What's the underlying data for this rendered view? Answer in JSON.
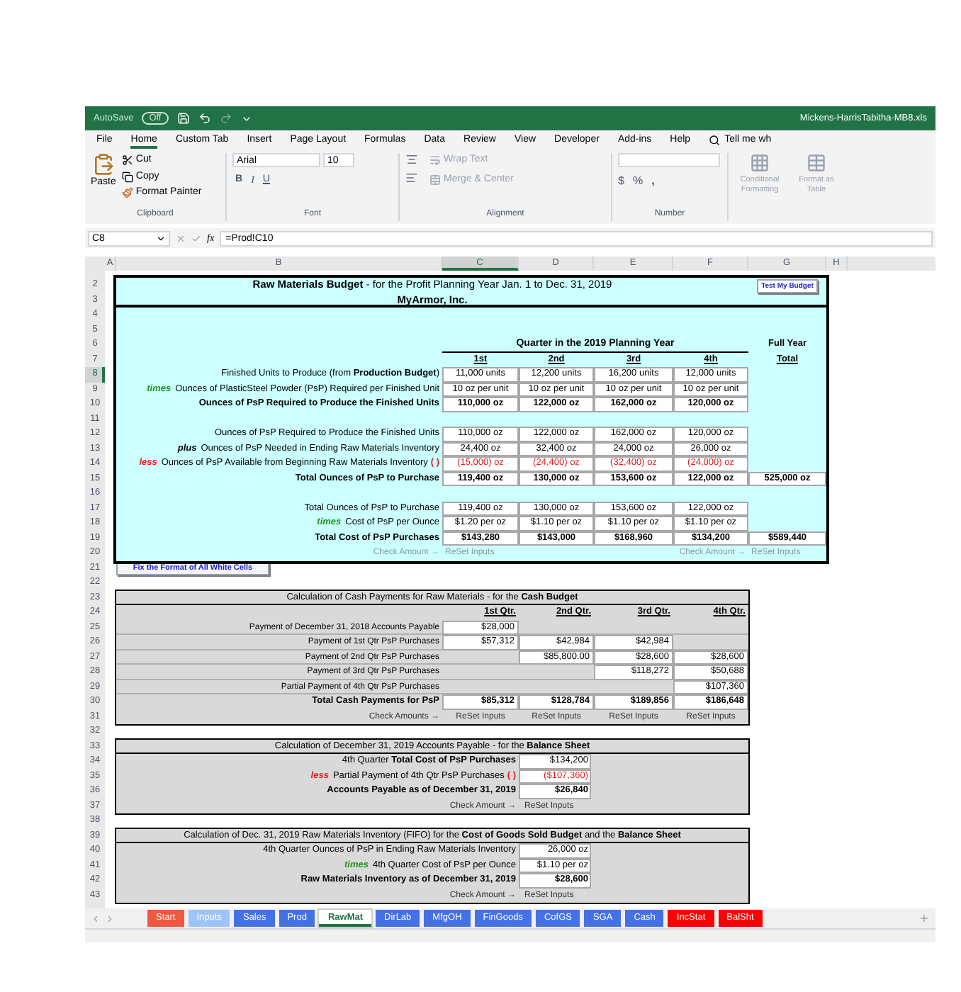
{
  "title_bar": {
    "autosave": "AutoSave",
    "autosave_state": "Off",
    "file_name": "Mickens-HarrisTabitha-MB8.xls"
  },
  "ribbon_tabs": [
    {
      "label": "File",
      "selected": false
    },
    {
      "label": "Home",
      "selected": true
    },
    {
      "label": "Custom Tab",
      "selected": false
    },
    {
      "label": "Insert",
      "selected": false
    },
    {
      "label": "Page Layout",
      "selected": false
    },
    {
      "label": "Formulas",
      "selected": false
    },
    {
      "label": "Data",
      "selected": false
    },
    {
      "label": "Review",
      "selected": false
    },
    {
      "label": "View",
      "selected": false
    },
    {
      "label": "Developer",
      "selected": false
    },
    {
      "label": "Add-ins",
      "selected": false
    },
    {
      "label": "Help",
      "selected": false
    }
  ],
  "tell_me": "Tell me wh",
  "ribbon": {
    "clipboard": {
      "paste": "Paste",
      "cut": "Cut",
      "copy": "Copy",
      "format_painter": "Format Painter",
      "group": "Clipboard"
    },
    "font": {
      "name": "Arial",
      "size": "10",
      "bold": "B",
      "italic": "I",
      "underline": "U",
      "group": "Font"
    },
    "alignment": {
      "wrap": "Wrap Text",
      "merge": "Merge & Center",
      "group": "Alignment"
    },
    "number": {
      "currency": "$",
      "percent": "%",
      "comma": ",",
      "group": "Number"
    },
    "styles": [
      {
        "label": "Conditional Formatting"
      },
      {
        "label": "Format as Table"
      }
    ]
  },
  "formula_bar": {
    "cell": "C8",
    "fx": "fx",
    "formula": "=Prod!C10"
  },
  "columns": [
    {
      "label": "A",
      "selected": false
    },
    {
      "label": "B",
      "selected": false
    },
    {
      "label": "C",
      "selected": true
    },
    {
      "label": "D",
      "selected": false
    },
    {
      "label": "E",
      "selected": false
    },
    {
      "label": "F",
      "selected": false
    },
    {
      "label": "G",
      "selected": false
    },
    {
      "label": "H",
      "selected": false
    }
  ],
  "row_numbers": [
    {
      "label": "2",
      "selected": false
    },
    {
      "label": "3",
      "selected": false
    },
    {
      "label": "4",
      "selected": false
    },
    {
      "label": "5",
      "selected": false
    },
    {
      "label": "6",
      "selected": false
    },
    {
      "label": "7",
      "selected": false
    },
    {
      "label": "8",
      "selected": true
    },
    {
      "label": "9",
      "selected": false
    },
    {
      "label": "10",
      "selected": false
    },
    {
      "label": "11",
      "selected": false
    },
    {
      "label": "12",
      "selected": false
    },
    {
      "label": "13",
      "selected": false
    },
    {
      "label": "14",
      "selected": false
    },
    {
      "label": "15",
      "selected": false
    },
    {
      "label": "16",
      "selected": false
    },
    {
      "label": "17",
      "selected": false
    },
    {
      "label": "18",
      "selected": false
    },
    {
      "label": "19",
      "selected": false
    },
    {
      "label": "20",
      "selected": false
    },
    {
      "label": "21",
      "selected": false
    },
    {
      "label": "22",
      "selected": false
    },
    {
      "label": "23",
      "selected": false
    },
    {
      "label": "24",
      "selected": false
    },
    {
      "label": "25",
      "selected": false
    },
    {
      "label": "26",
      "selected": false
    },
    {
      "label": "27",
      "selected": false
    },
    {
      "label": "28",
      "selected": false
    },
    {
      "label": "29",
      "selected": false
    },
    {
      "label": "30",
      "selected": false
    },
    {
      "label": "31",
      "selected": false
    },
    {
      "label": "32",
      "selected": false
    },
    {
      "label": "33",
      "selected": false
    },
    {
      "label": "34",
      "selected": false
    },
    {
      "label": "35",
      "selected": false
    },
    {
      "label": "36",
      "selected": false
    },
    {
      "label": "37",
      "selected": false
    },
    {
      "label": "38",
      "selected": false
    },
    {
      "label": "39",
      "selected": false
    },
    {
      "label": "40",
      "selected": false
    },
    {
      "label": "41",
      "selected": false
    },
    {
      "label": "42",
      "selected": false
    },
    {
      "label": "43",
      "selected": false
    }
  ],
  "budget": {
    "title": "**Raw Materials Budget** - for the Profit Planning Year Jan. 1 to Dec. 31, 2019",
    "company": "MyArmor, Inc.",
    "test_button": "Test My Budget",
    "quarter_header": "Quarter in the 2019 Planning Year",
    "total_header": [
      "Full Year",
      "Total"
    ],
    "quarters": [
      "1st",
      "2nd",
      "3rd",
      "4th"
    ],
    "groups": [
      [
        {
          "label": "Finished Units to Produce (from **Production Budget**)",
          "values": [
            "11,000 units",
            "12,200 units",
            "16,200 units",
            "12,000 units"
          ]
        },
        {
          "prefix": {
            "text": "times",
            "kind": "times"
          },
          "label": "Ounces of PlasticSteel Powder (PsP) Required per Finished Unit",
          "values": [
            "10 oz per unit",
            "10 oz per unit",
            "10 oz per unit",
            "10 oz per unit"
          ]
        },
        {
          "label": "Ounces of PsP Required to Produce the Finished Units",
          "bold": true,
          "values": [
            "110,000 oz",
            "122,000 oz",
            "162,000 oz",
            "120,000 oz"
          ]
        }
      ],
      [
        {
          "label": "Ounces of PsP Required to Produce the Finished Units",
          "values": [
            "110,000 oz",
            "122,000 oz",
            "162,000 oz",
            "120,000 oz"
          ]
        },
        {
          "prefix": {
            "text": "plus",
            "kind": "plus"
          },
          "label": "Ounces of PsP Needed in Ending Raw Materials Inventory",
          "values": [
            "24,400 oz",
            "32,400 oz",
            "24,000 oz",
            "26,000 oz"
          ]
        },
        {
          "prefix": {
            "text": "less",
            "kind": "less"
          },
          "label": "Ounces of PsP Available from Beginning Raw Materials Inventory",
          "suffix": "( )",
          "negative": true,
          "values": [
            "(15,000) oz",
            "(24,400) oz",
            "(32,400) oz",
            "(24,000) oz"
          ]
        },
        {
          "label": "Total Ounces of PsP to Purchase",
          "bold": true,
          "values": [
            "119,400 oz",
            "130,000 oz",
            "153,600 oz",
            "122,000 oz"
          ],
          "total": "525,000 oz"
        }
      ],
      [
        {
          "label": "Total Ounces of PsP to Purchase",
          "values": [
            "119,400 oz",
            "130,000 oz",
            "153,600 oz",
            "122,000 oz"
          ]
        },
        {
          "prefix": {
            "text": "times",
            "kind": "times"
          },
          "label": "Cost of PsP per Ounce",
          "values": [
            "$1.20 per oz",
            "$1.10 per oz",
            "$1.10 per oz",
            "$1.10 per oz"
          ]
        },
        {
          "label": "Total Cost of PsP Purchases",
          "bold": true,
          "values": [
            "$143,280",
            "$143,000",
            "$168,960",
            "$134,200"
          ],
          "total": "$589,440"
        }
      ]
    ],
    "checks": [
      {
        "label": "Check Amount →",
        "action": "ReSet Inputs"
      },
      {
        "label": "Check Amount →",
        "action": "ReSet Inputs"
      }
    ]
  },
  "fix_button": "Fix the Format of All White Cells",
  "cash": {
    "title": "Calculation of Cash Payments for Raw Materials - for the **Cash Budget**",
    "quarters": [
      "1st Qtr.",
      "2nd Qtr.",
      "3rd Qtr.",
      "4th Qtr."
    ],
    "rows": [
      {
        "label": "Payment of  December 31, 2018 Accounts Payable",
        "cells": [
          {
            "kind": "value",
            "text": "$28,000"
          },
          {
            "kind": "blank"
          },
          {
            "kind": "blank"
          },
          {
            "kind": "blank"
          }
        ]
      },
      {
        "label": "Payment of 1st Qtr PsP Purchases",
        "cells": [
          {
            "kind": "value",
            "text": "$57,312"
          },
          {
            "kind": "value",
            "text": "$42,984"
          },
          {
            "kind": "value",
            "text": "$42,984"
          },
          {
            "kind": "blank"
          }
        ]
      },
      {
        "label": "Payment of 2nd Qtr PsP Purchases",
        "cells": [
          {
            "kind": "blank"
          },
          {
            "kind": "value",
            "text": "$85,800.00"
          },
          {
            "kind": "value",
            "text": "$28,600"
          },
          {
            "kind": "value",
            "text": "$28,600"
          }
        ]
      },
      {
        "label": "Payment of 3rd Qtr PsP Purchases",
        "cells": [
          {
            "kind": "blank"
          },
          {
            "kind": "blank"
          },
          {
            "kind": "value",
            "text": "$118,272"
          },
          {
            "kind": "value",
            "text": "$50,688"
          }
        ]
      },
      {
        "label": "Partial Payment of 4th Qtr PsP Purchases",
        "cells": [
          {
            "kind": "blank"
          },
          {
            "kind": "blank"
          },
          {
            "kind": "blank"
          },
          {
            "kind": "value",
            "text": "$107,360"
          }
        ]
      }
    ],
    "total": {
      "label": "Total Cash Payments for PsP",
      "values": [
        "$85,312",
        "$128,784",
        "$189,856",
        "$186,648"
      ]
    },
    "check": {
      "label": "Check Amounts →",
      "actions": [
        "ReSet Inputs",
        "ReSet Inputs",
        "ReSet Inputs",
        "ReSet Inputs"
      ]
    }
  },
  "payable": {
    "title": "Calculation of December 31, 2019 Accounts Payable - for the **Balance Sheet**",
    "rows": [
      {
        "label": "4th Quarter **Total Cost of PsP Purchases**",
        "value": "$134,200"
      },
      {
        "prefix": {
          "text": "less",
          "kind": "less"
        },
        "label": "Partial Payment of 4th Qtr PsP Purchases",
        "suffix": "( )",
        "negative": true,
        "value": "($107,360)"
      },
      {
        "label": "Accounts Payable as of December 31, 2019",
        "bold": true,
        "value": "$26,840"
      }
    ],
    "check": {
      "label": "Check Amount →",
      "action": "ReSet Inputs"
    }
  },
  "inventory": {
    "title": "Calculation of Dec. 31, 2019 Raw Materials Inventory (FIFO) for the **Cost of Goods Sold Budget** and the **Balance Sheet**",
    "rows": [
      {
        "label": "4th Quarter Ounces of PsP in Ending Raw Materials Inventory",
        "value": "26,000 oz"
      },
      {
        "prefix": {
          "text": "times",
          "kind": "times"
        },
        "label": "4th Quarter Cost of PsP per Ounce",
        "value": "$1.10 per oz"
      },
      {
        "label": "Raw Materials Inventory as of December 31, 2019",
        "bold": true,
        "value": "$28,600"
      }
    ],
    "check": {
      "label": "Check Amount →",
      "action": "ReSet Inputs"
    }
  },
  "sheet_tabs": [
    {
      "label": "Start",
      "color": "#f0573e",
      "selected": false
    },
    {
      "label": "Inputs",
      "color": "#9fc5f8",
      "selected": false
    },
    {
      "label": "Sales",
      "color": "#4472e6",
      "selected": false
    },
    {
      "label": "Prod",
      "color": "#4472e6",
      "selected": false
    },
    {
      "label": "RawMat",
      "color": "#ffffff",
      "selected": true
    },
    {
      "label": "DirLab",
      "color": "#4472e6",
      "selected": false
    },
    {
      "label": "MfgOH",
      "color": "#4472e6",
      "selected": false
    },
    {
      "label": "FinGoods",
      "color": "#4472e6",
      "selected": false
    },
    {
      "label": "CofGS",
      "color": "#4472e6",
      "selected": false
    },
    {
      "label": "SGA",
      "color": "#4472e6",
      "selected": false
    },
    {
      "label": "Cash",
      "color": "#4472e6",
      "selected": false
    },
    {
      "label": "IncStat",
      "color": "#ff0000",
      "selected": false
    },
    {
      "label": "BalSht",
      "color": "#ff0000",
      "selected": false
    }
  ]
}
